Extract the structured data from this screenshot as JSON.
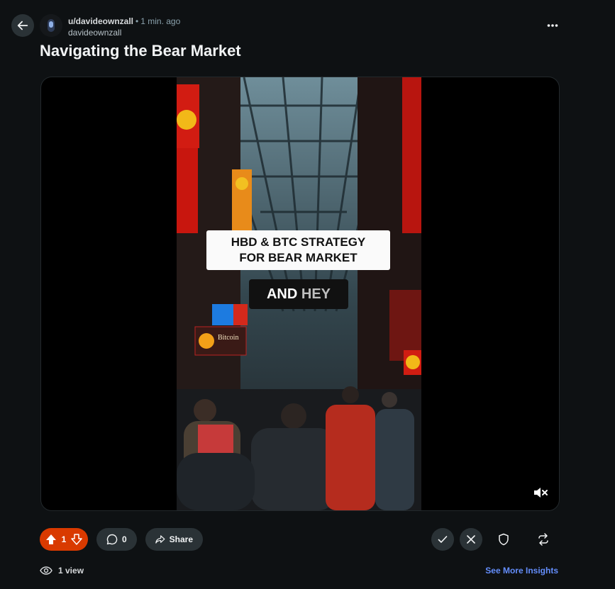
{
  "post": {
    "username": "u/davideownzall",
    "separator": "•",
    "time_ago": "1 min. ago",
    "display_name": "davideownzall",
    "title": "Navigating the Bear Market"
  },
  "video": {
    "caption_line1": "HBD & BTC STRATEGY",
    "caption_line2": "FOR BEAR MARKET",
    "caption_word1": "AND",
    "caption_word2": "HEY",
    "sign_text": "Bitcoin"
  },
  "actions": {
    "upvote_count": "1",
    "comment_count": "0",
    "share_label": "Share"
  },
  "footer": {
    "views_label": "1 view",
    "insights_label": "See More Insights"
  },
  "icons": {
    "back": "arrow-left-icon",
    "more": "more-dots-icon",
    "mute": "muted-speaker-icon",
    "upvote": "upvote-arrow-icon",
    "downvote": "downvote-arrow-icon",
    "comment": "comment-bubble-icon",
    "share": "share-arrow-icon",
    "approve": "checkmark-icon",
    "remove": "close-icon",
    "moderate": "shield-icon",
    "crosspost": "crosspost-icon",
    "views": "eye-icon"
  },
  "colors": {
    "background": "#0e1113",
    "upvote_active": "#d93a00",
    "link": "#648efc",
    "button": "#2a3236"
  }
}
